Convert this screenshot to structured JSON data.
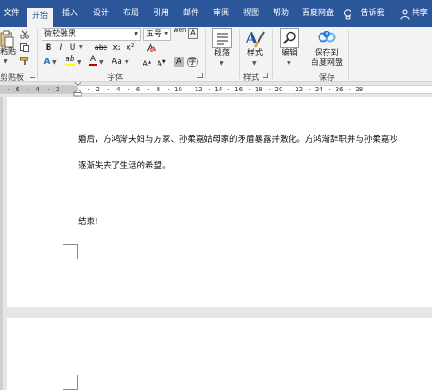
{
  "tabs": {
    "file": "文件",
    "home": "开始",
    "insert": "插入",
    "design": "设计",
    "layout": "布局",
    "references": "引用",
    "mailings": "邮件",
    "review": "审阅",
    "view": "视图",
    "help": "帮助",
    "baidu": "百度网盘",
    "tell_me": "告诉我",
    "share": "共享"
  },
  "ribbon": {
    "clipboard": {
      "paste_label": "粘贴",
      "group_label": "剪贴板"
    },
    "font": {
      "font_name": "微软雅黑",
      "font_size": "五号",
      "bold": "B",
      "italic": "I",
      "underline": "U",
      "strikethrough": "abc",
      "subscript": "x₂",
      "superscript": "x²",
      "text_effects": "A",
      "highlight": "ab",
      "font_color": "A",
      "change_case": "Aa",
      "grow_font": "A",
      "shrink_font": "A",
      "char_shading": "A",
      "char_border": "A",
      "phonetic": "wén",
      "group_label": "字体"
    },
    "paragraph": {
      "label": "段落"
    },
    "styles": {
      "label": "样式",
      "group_label": "样式"
    },
    "editing": {
      "label": "编辑"
    },
    "save": {
      "label_line1": "保存到",
      "label_line2": "百度网盘",
      "group_label": "保存"
    }
  },
  "ruler": {
    "numbers": [
      "6",
      "4",
      "2",
      "2",
      "4",
      "6",
      "8",
      "10",
      "12",
      "14",
      "16",
      "18",
      "20",
      "22",
      "24",
      "26",
      "28"
    ]
  },
  "document": {
    "line1": "婚后，方鸿渐夫妇与方家、孙柔嘉姑母家的矛盾暴露并激化。方鸿渐辞职并与孙柔嘉吵",
    "line2": "逐渐失去了生活的希望。",
    "line3": "结束!"
  },
  "colors": {
    "accent": "#2b579a",
    "ribbon_bg": "#f3f3f3",
    "canvas_bg": "#e6e6e6"
  }
}
